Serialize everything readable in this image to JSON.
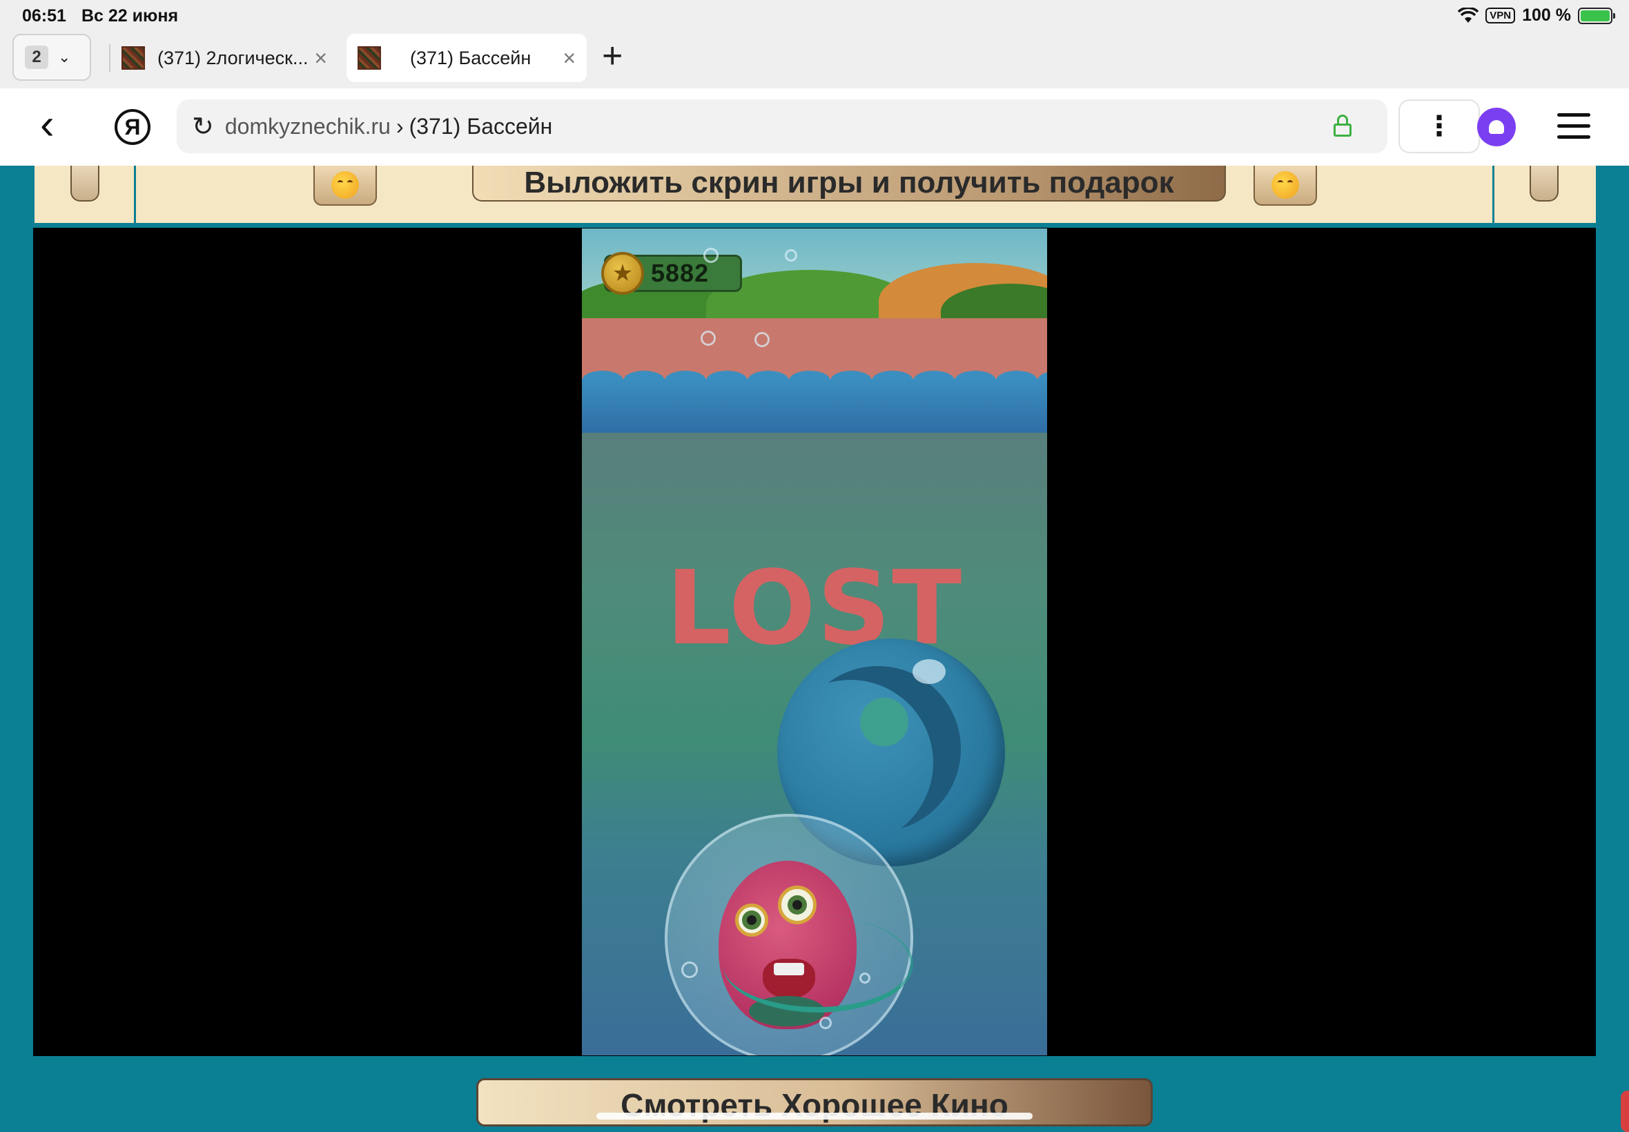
{
  "status_bar": {
    "time": "06:51",
    "date": "Вс 22 июня",
    "vpn": "VPN",
    "battery": "100 %"
  },
  "tabs": {
    "count": "2",
    "items": [
      {
        "label": "(371) 2логическ..."
      },
      {
        "label": "(371) Бассейн"
      }
    ]
  },
  "address": {
    "host": "domkyznechik.ru",
    "separator": "›",
    "page": "(371) Бассейн"
  },
  "banner": {
    "button_label": "Выложить скрин игры и получить подарок",
    "emoji": "hugging-face"
  },
  "game": {
    "coins": "5882",
    "status": "LOST"
  },
  "bottom": {
    "button_label": "Смотреть Хорошее Кино"
  },
  "colors": {
    "page_bg": "#0b7f94",
    "banner_bg": "#f6e7c4",
    "lost_text": "#d56363",
    "alice": "#7b3ff2",
    "lock": "#3cb043"
  }
}
